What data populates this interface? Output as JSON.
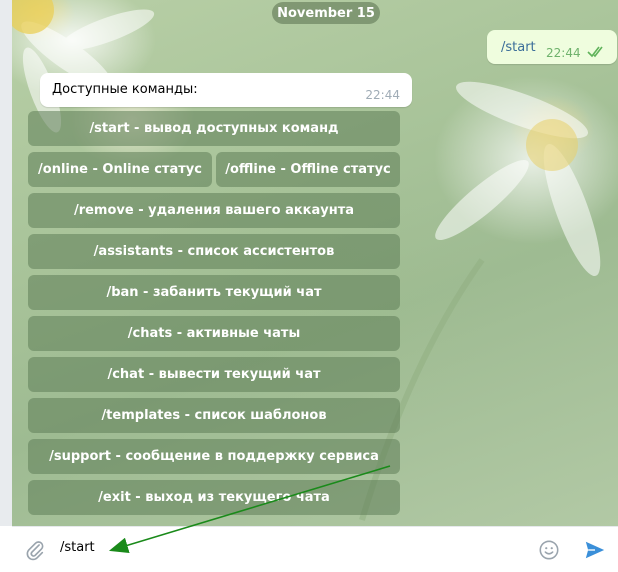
{
  "date_separator": "November 15",
  "outgoing": {
    "text": "/start",
    "time": "22:44",
    "status_icon": "double-check-icon"
  },
  "incoming": {
    "text": "Доступные команды:",
    "time": "22:44"
  },
  "keyboard": {
    "rows": [
      [
        "/start - вывод доступных команд"
      ],
      [
        "/online - Online статус",
        "/offline - Offline статус"
      ],
      [
        "/remove - удаления вашего аккаунта"
      ],
      [
        "/assistants - список ассистентов"
      ],
      [
        "/ban - забанить текущий чат"
      ],
      [
        "/chats - активные чаты"
      ],
      [
        "/chat - вывести текущий чат"
      ],
      [
        "/templates - список шаблонов"
      ],
      [
        "/support - сообщение в поддержку сервиса"
      ],
      [
        "/exit - выход из текущего чата"
      ]
    ]
  },
  "composer": {
    "input_value": "/start",
    "attach_icon": "paperclip-icon",
    "emoji_icon": "smiley-icon",
    "send_icon": "send-arrow-icon"
  },
  "colors": {
    "annotation_arrow": "#1a8a1a",
    "accent": "#3a8fd9"
  }
}
